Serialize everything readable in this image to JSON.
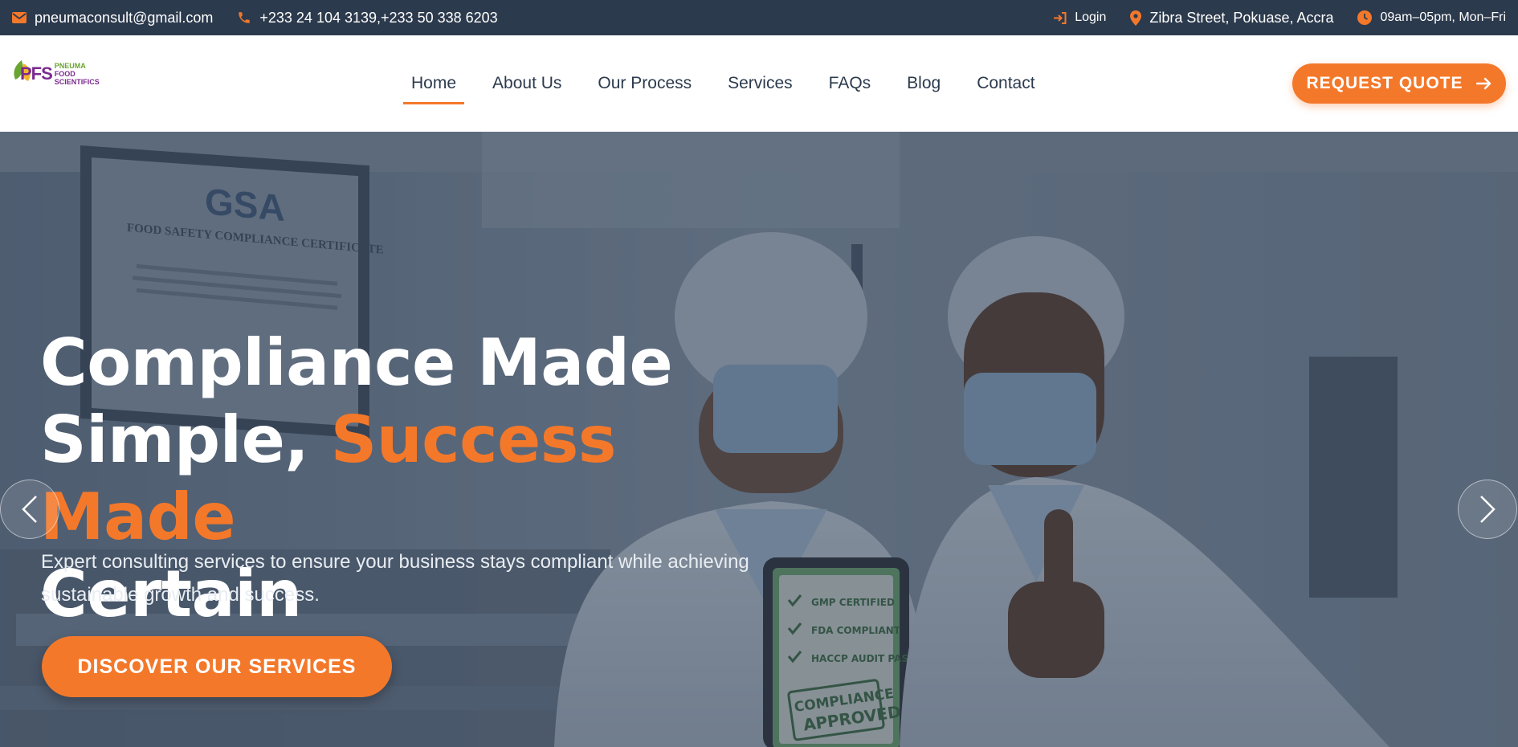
{
  "topbar": {
    "email": "pneumaconsult@gmail.com",
    "phone": "+233 24 104 3139,+233 50 338 6203",
    "login": "Login",
    "address": "Zibra Street, Pokuase, Accra",
    "hours": "09am–05pm, Mon–Fri"
  },
  "header": {
    "logo": {
      "mark": "PFS",
      "line1": "PNEUMA",
      "line2": "FOOD",
      "line3": "SCIENTIFICS"
    },
    "nav": [
      "Home",
      "About Us",
      "Our Process",
      "Services",
      "FAQs",
      "Blog",
      "Contact"
    ],
    "active_nav": "Home",
    "quote_label": "REQUEST QUOTE"
  },
  "hero": {
    "title_line1": "Compliance Made",
    "title_line2_plain": "Simple, ",
    "title_line2_accent": "Success Made",
    "title_line3": "Certain",
    "subtitle": "Expert consulting services to ensure your business stays compliant while achieving sustainable growth and success.",
    "cta_label": "DISCOVER OUR SERVICES",
    "certificate": {
      "brand": "GSA",
      "heading": "FOOD SAFETY COMPLIANCE CERTIFICATE"
    },
    "tablet": {
      "items": [
        "GMP CERTIFIED",
        "FDA COMPLIANT",
        "HACCP AUDIT PASS"
      ],
      "stamp_line1": "COMPLIANCE",
      "stamp_line2": "APPROVED"
    }
  },
  "colors": {
    "topbar_bg": "#2c3a4d",
    "accent": "#f4782a",
    "nav_text": "#2c3a4d"
  }
}
